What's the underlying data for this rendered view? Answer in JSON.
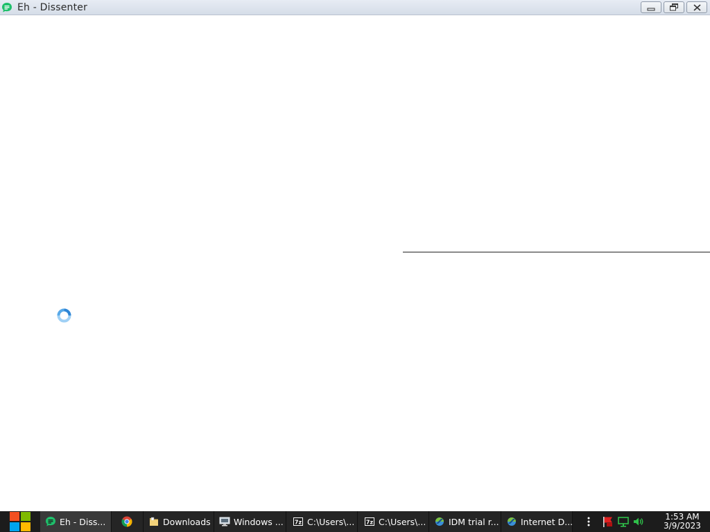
{
  "window": {
    "title": "Eh - Dissenter",
    "app_icon": "dissenter-app-icon",
    "controls": [
      "minimize-icon",
      "restore-icon",
      "close-icon"
    ]
  },
  "content": {
    "state": "loading",
    "spinner_icon": "loading-spinner-icon"
  },
  "taskbar": {
    "start_icon": "windows-logo-icon",
    "items": [
      {
        "label": "Eh - Diss...",
        "icon": "dissenter-app-icon",
        "active": true
      },
      {
        "label": "",
        "icon": "chrome-icon",
        "active": false
      },
      {
        "label": "Downloads",
        "icon": "folder-icon",
        "active": false
      },
      {
        "label": "Windows ...",
        "icon": "computer-monitor-icon",
        "active": false
      },
      {
        "label": "C:\\Users\\...",
        "icon": "7zip-icon",
        "active": false
      },
      {
        "label": "C:\\Users\\...",
        "icon": "7zip-icon",
        "active": false
      },
      {
        "label": "IDM trial r...",
        "icon": "idm-icon",
        "active": false
      },
      {
        "label": "Internet D...",
        "icon": "idm-icon",
        "active": false
      }
    ],
    "tray": {
      "icons": [
        "overflow-menu-icon",
        "action-center-flag-icon",
        "network-icon",
        "volume-icon"
      ],
      "time": "1:53 AM",
      "date": "3/9/2023"
    }
  },
  "colors": {
    "dissenter_green": "#1fbf6b",
    "spinner_blue": "#2f86d6",
    "taskbar_bg": "#1c1c1c",
    "flag_red": "#e02020"
  }
}
